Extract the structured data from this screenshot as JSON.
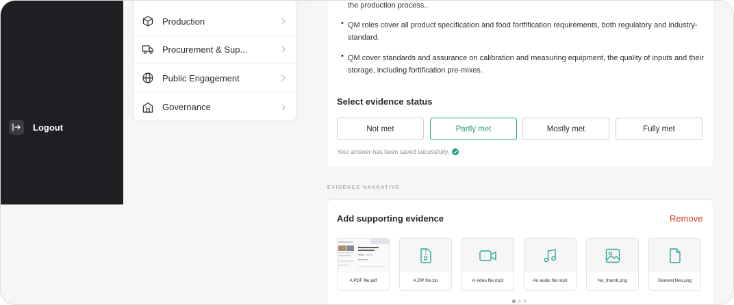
{
  "sidebar": {
    "logout_label": "Logout"
  },
  "categories": [
    {
      "label": "Production",
      "icon": "box-icon"
    },
    {
      "label": "Procurement & Sup...",
      "icon": "truck-icon"
    },
    {
      "label": "Public Engagement",
      "icon": "globe-icon"
    },
    {
      "label": "Governance",
      "icon": "building-icon"
    }
  ],
  "criteria": {
    "bullets": [
      "the production process..",
      "QM roles cover all product specification and food fortfification requirements, both regulatory and industry-standard.",
      "QM cover standards and assurance on calibration and measuring equipment, the quality of inputs and their storage, including fortification pre-mixes."
    ]
  },
  "status": {
    "title": "Select evidence status",
    "options": [
      "Not met",
      "Partly met",
      "Mostly  met",
      "Fully  met"
    ],
    "selected": "Partly met",
    "saved_message": "Your answer has been saved sucessfully."
  },
  "narrative": {
    "label": "EVIDENCE NARRATIVE"
  },
  "evidence": {
    "title": "Add supporting evidence",
    "remove_label": "Remove",
    "files": [
      {
        "name": "A PDF file.pdf",
        "icon": "pdf-preview"
      },
      {
        "name": "A ZIP file.zip",
        "icon": "zip-icon"
      },
      {
        "name": "A video file.mp3",
        "icon": "video-icon"
      },
      {
        "name": "An audio file.mp3",
        "icon": "music-icon"
      },
      {
        "name": "No_thumb.png",
        "icon": "image-icon"
      },
      {
        "name": "General files.png",
        "icon": "file-icon"
      }
    ],
    "pager": {
      "pages": 3,
      "current": 1
    }
  },
  "colors": {
    "sidebar_bg": "#1d1f22",
    "accent": "#25a28b",
    "remove": "#d9402b",
    "file_icon": "#2aa79b"
  }
}
